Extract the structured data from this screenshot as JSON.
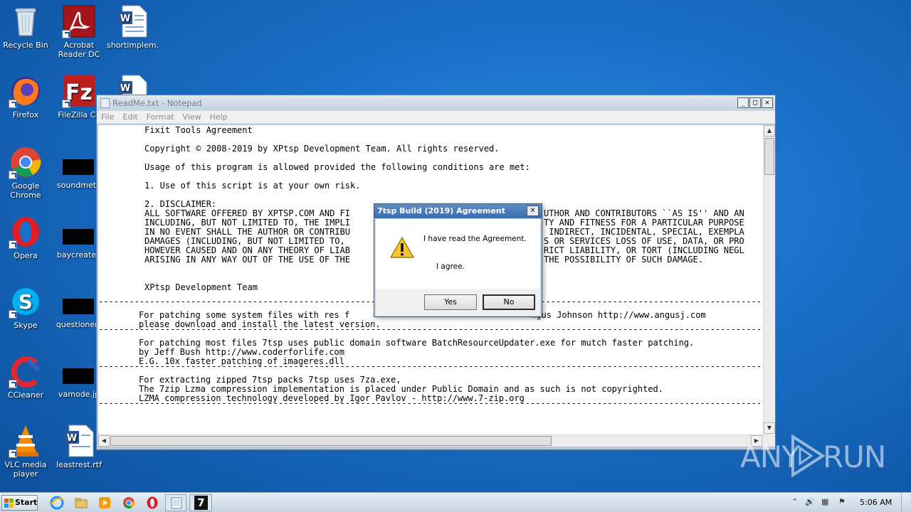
{
  "desktop": {
    "icons": [
      {
        "label": "Recycle Bin"
      },
      {
        "label": "Acrobat Reader DC"
      },
      {
        "label": "shortimplem..."
      },
      {
        "label": "Firefox"
      },
      {
        "label": "FileZilla Cli"
      },
      {
        "label": "Google Chrome"
      },
      {
        "label": "soundmeth"
      },
      {
        "label": "Opera"
      },
      {
        "label": "baycreated"
      },
      {
        "label": "Skype"
      },
      {
        "label": "questionenl"
      },
      {
        "label": "CCleaner"
      },
      {
        "label": "vamode.jp"
      },
      {
        "label": "VLC media player"
      },
      {
        "label": "leastrest.rtf"
      }
    ]
  },
  "notepad": {
    "title": "ReadMe.txt - Notepad",
    "menu": [
      "File",
      "Edit",
      "Format",
      "View",
      "Help"
    ],
    "lines": [
      "Fixit Tools Agreement",
      "Copyright © 2008-2019 by XPtsp Development Team. All rights reserved.",
      "Usage of this program is allowed provided the following conditions are met:",
      "1. Use of this script is at your own risk.",
      "2. DISCLAIMER:",
      "ALL SOFTWARE OFFERED BY XPTSP.COM AND FI",
      "INCLUDING, BUT NOT LIMITED TO, THE IMPLI",
      "IN NO EVENT SHALL THE AUTHOR OR CONTRIBU",
      "DAMAGES (INCLUDING, BUT NOT LIMITED TO,",
      "HOWEVER CAUSED AND ON ANY THEORY OF LIAB",
      "ARISING IN ANY WAY OUT OF THE USE OF THE",
      "XPtsp Development Team",
      "For patching some system files with res f",
      "please download and install the latest version.",
      "For patching most files 7tsp uses public domain software BatchResourceUpdater.exe for mutch faster patching.",
      "by Jeff Bush http://www.coderforlife.com",
      "E.G. 10x faster patching of imageres.dll",
      "For extracting zipped 7tsp packs 7tsp uses 7za.exe,",
      "The 7zip Lzma compression implementation is placed under Public Domain and as such is not copyrighted.",
      "LZMA compression technology developed by Igor Pavlov - http://www.7-zip.org"
    ],
    "right_fragments": [
      "UTHOR AND CONTRIBUTORS ``AS IS'' AND AN",
      "TY AND FITNESS FOR A PARTICULAR PURPOSE",
      " INDIRECT, INCIDENTAL, SPECIAL, EXEMPLA",
      "S OR SERVICES LOSS OF USE, DATA, OR PRO",
      "RICT LIABILITY, OR TORT (INCLUDING NEGL",
      "THE POSSIBILITY OF SUCH DAMAGE.",
      "ngus Johnson http://www.angusj.com"
    ],
    "dashes": "----------------------------------------------------------------------------------------------------------------------------------"
  },
  "dialog": {
    "title": "7tsp Build (2019) Agreement",
    "close": "✕",
    "message1": "I have read the Agreement.",
    "message2": "I agree.",
    "yes": "Yes",
    "no": "No"
  },
  "taskbar": {
    "start": "Start",
    "clock": "5:06 AM",
    "active_app": "7"
  },
  "watermark": {
    "left": "ANY",
    "right": "RUN"
  },
  "colors": {
    "desktop": "#1a6fc8",
    "dialog_title": "#3a6cae"
  }
}
